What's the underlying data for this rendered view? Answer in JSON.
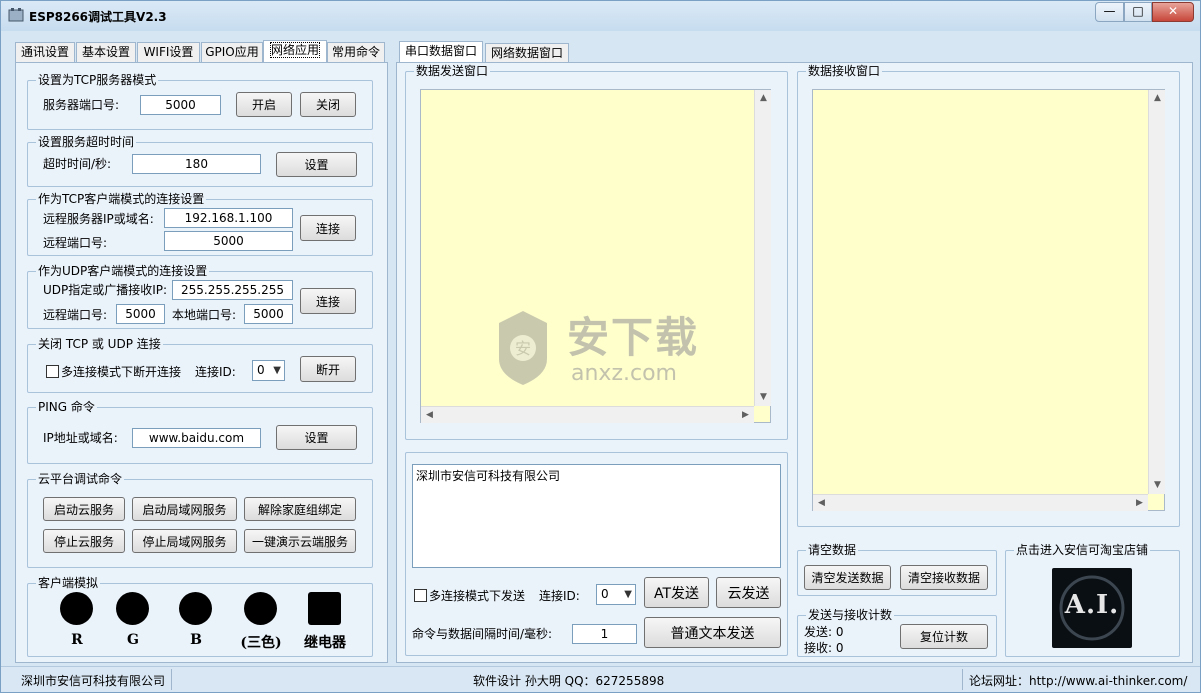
{
  "window": {
    "title": "ESP8266调试工具V2.3",
    "min_glyph": "—",
    "max_glyph": "□",
    "close_glyph": "✕"
  },
  "left_tabs": [
    "通讯设置",
    "基本设置",
    "WIFI设置",
    "GPIO应用",
    "网络应用",
    "常用命令"
  ],
  "left_active_tab": "网络应用",
  "tcp_server": {
    "title": "设置为TCP服务器模式",
    "port_label": "服务器端口号:",
    "port_value": "5000",
    "open_label": "开启",
    "close_label": "关闭"
  },
  "timeout": {
    "title": "设置服务超时时间",
    "label": "超时时间/秒:",
    "value": "180",
    "set_label": "设置"
  },
  "tcp_client": {
    "title": "作为TCP客户端模式的连接设置",
    "ip_label": "远程服务器IP或域名:",
    "ip_value": "192.168.1.100",
    "port_label": "远程端口号:",
    "port_value": "5000",
    "connect_label": "连接"
  },
  "udp_client": {
    "title": "作为UDP客户端模式的连接设置",
    "ip_label": "UDP指定或广播接收IP:",
    "ip_value": "255.255.255.255",
    "remote_port_label": "远程端口号:",
    "remote_port_value": "5000",
    "local_port_label": "本地端口号:",
    "local_port_value": "5000",
    "connect_label": "连接"
  },
  "close_conn": {
    "title": "关闭 TCP 或 UDP 连接",
    "multi_label": "多连接模式下断开连接",
    "id_label": "连接ID:",
    "id_value": "0",
    "disconnect_label": "断开"
  },
  "ping": {
    "title": "PING 命令",
    "label": "IP地址或域名:",
    "value": "www.baidu.com",
    "set_label": "设置"
  },
  "cloud": {
    "title": "云平台调试命令",
    "buttons": [
      "启动云服务",
      "启动局域网服务",
      "解除家庭组绑定",
      "停止云服务",
      "停止局域网服务",
      "一键演示云端服务"
    ]
  },
  "client_sim": {
    "title": "客户端模拟",
    "labels": [
      "R",
      "G",
      "B",
      "(三色)",
      "继电器"
    ]
  },
  "right_tabs": [
    "串口数据窗口",
    "网络数据窗口"
  ],
  "right_active_tab": "串口数据窗口",
  "send_window": {
    "title": "数据发送窗口"
  },
  "recv_window": {
    "title": "数据接收窗口"
  },
  "send_box": {
    "text": "深圳市安信可科技有限公司",
    "multi_label": "多连接模式下发送",
    "id_label": "连接ID:",
    "id_value": "0",
    "at_send_label": "AT发送",
    "cloud_send_label": "云发送",
    "interval_label": "命令与数据间隔时间/毫秒:",
    "interval_value": "1",
    "text_send_label": "普通文本发送"
  },
  "clear": {
    "title": "请空数据",
    "clear_send_label": "清空发送数据",
    "clear_recv_label": "清空接收数据"
  },
  "counter": {
    "title": "发送与接收计数",
    "send_label": "发送: 0",
    "recv_label": "接收: 0",
    "reset_label": "复位计数"
  },
  "shop": {
    "title": "点击进入安信可淘宝店铺",
    "logo_text": "A.I."
  },
  "watermark": {
    "cn": "安下载",
    "en": "anxz.com"
  },
  "status": {
    "company": "深圳市安信可科技有限公司",
    "design": "软件设计 孙大明 QQ：627255898",
    "forum": "论坛网址：http://www.ai-thinker.com/"
  }
}
